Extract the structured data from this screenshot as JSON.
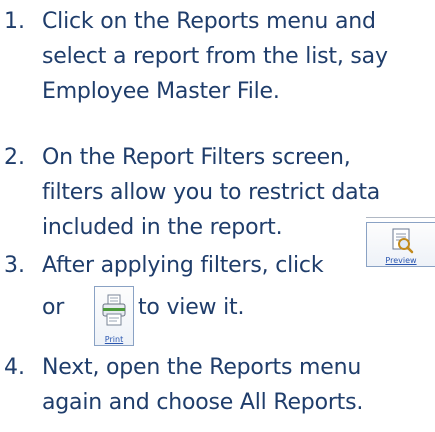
{
  "steps": [
    {
      "number": "1.",
      "lines": [
        "Click on the Reports menu and",
        "select a report from the list, say",
        "Employee Master File."
      ]
    },
    {
      "number": "2.",
      "lines": [
        "On the Report Filters screen,",
        "filters allow you to restrict data",
        "included in the report."
      ]
    },
    {
      "number": "3.",
      "line1": "After applying filters, click",
      "line2_before": "or",
      "line2_after": "to view it."
    },
    {
      "number": "4.",
      "lines": [
        "Next, open the Reports menu",
        "again and choose All Reports."
      ]
    }
  ],
  "buttons": {
    "preview_label": "Preview",
    "preview_icon": "preview-icon",
    "print_label": "Print",
    "print_icon": "print-icon"
  },
  "colors": {
    "text": "#1f3d6b",
    "button_label": "#2a56b0"
  }
}
